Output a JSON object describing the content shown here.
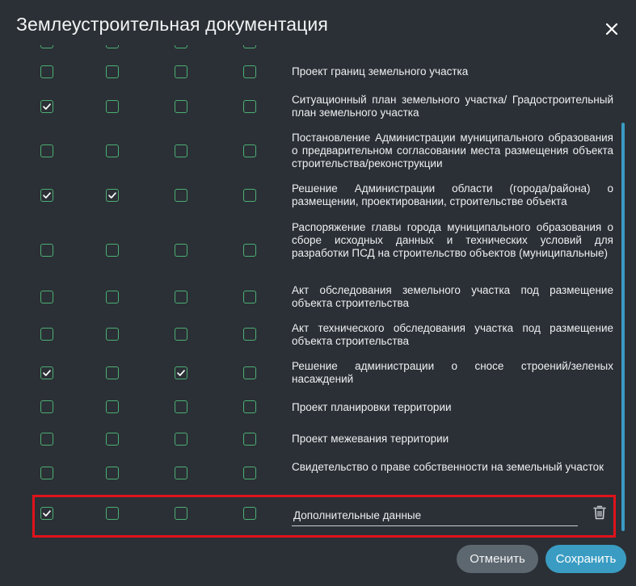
{
  "dialog": {
    "title": "Землеустроительная документация",
    "cancel_label": "Отменить",
    "save_label": "Сохранить"
  },
  "colors": {
    "background": "#2b3036",
    "checkbox_border": "#4caf73",
    "accent": "#3a9cc3",
    "highlight": "#e0121b"
  },
  "rows": [
    {
      "label": "Проект границ земельного участка",
      "checks": [
        false,
        false,
        false,
        false
      ]
    },
    {
      "label": "Ситуационный план земельного участка/ Градостроительный план земельного участка",
      "checks": [
        true,
        false,
        false,
        false
      ]
    },
    {
      "label": "Постановление Администрации муниципального образования о предварительном согласовании места размещения объекта строительства/реконструкции",
      "checks": [
        false,
        false,
        false,
        false
      ]
    },
    {
      "label": "Решение Администрации области (города/района) о размещении, проектировании, строительстве объекта",
      "checks": [
        true,
        true,
        false,
        false
      ]
    },
    {
      "label": "Распоряжение главы города муниципального образования о сборе исходных данных и технических условий для разработки ПСД на строительство объектов (муниципальные)",
      "checks": [
        false,
        false,
        false,
        false
      ]
    },
    {
      "label": "Акт обследования земельного участка под размещение объекта строительства",
      "checks": [
        false,
        false,
        false,
        false
      ]
    },
    {
      "label": "Акт технического обследования участка под размещение объекта строительства",
      "checks": [
        false,
        false,
        false,
        false
      ]
    },
    {
      "label": "Решение администрации о сносе строений/зеленых насаждений",
      "checks": [
        true,
        false,
        true,
        false
      ]
    },
    {
      "label": "Проект планировки территории",
      "checks": [
        false,
        false,
        false,
        false
      ]
    },
    {
      "label": "Проект межевания территории",
      "checks": [
        false,
        false,
        false,
        false
      ]
    },
    {
      "label": "Свидетельство о праве собственности на земельный участок",
      "checks": [
        false,
        false,
        false,
        false
      ]
    }
  ],
  "extra_row": {
    "value": "Дополнительные данные",
    "checks": [
      true,
      false,
      false,
      false
    ]
  }
}
